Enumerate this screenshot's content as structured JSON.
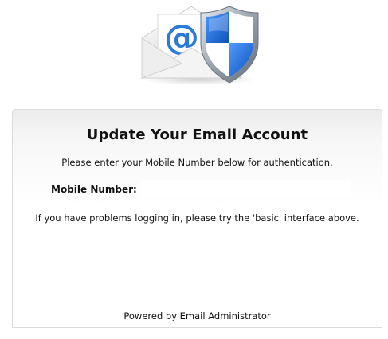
{
  "logo": {
    "icon": "email-security-shield-icon"
  },
  "form": {
    "title": "Update Your Email Account",
    "instruction": "Please enter your Mobile Number below for authentication.",
    "mobile_label": "Mobile Number:",
    "mobile_value": "",
    "help_text": "If you have problems logging in, please try the 'basic' interface above."
  },
  "footer": {
    "text": "Powered by Email Administrator"
  },
  "colors": {
    "envelope": "#f2f2f2",
    "at_sign": "#2a7bd6",
    "shield_blue": "#1565d8",
    "shield_white": "#ffffff",
    "shield_rim": "#9aa3ad",
    "panel_border": "#dcdcdc"
  }
}
